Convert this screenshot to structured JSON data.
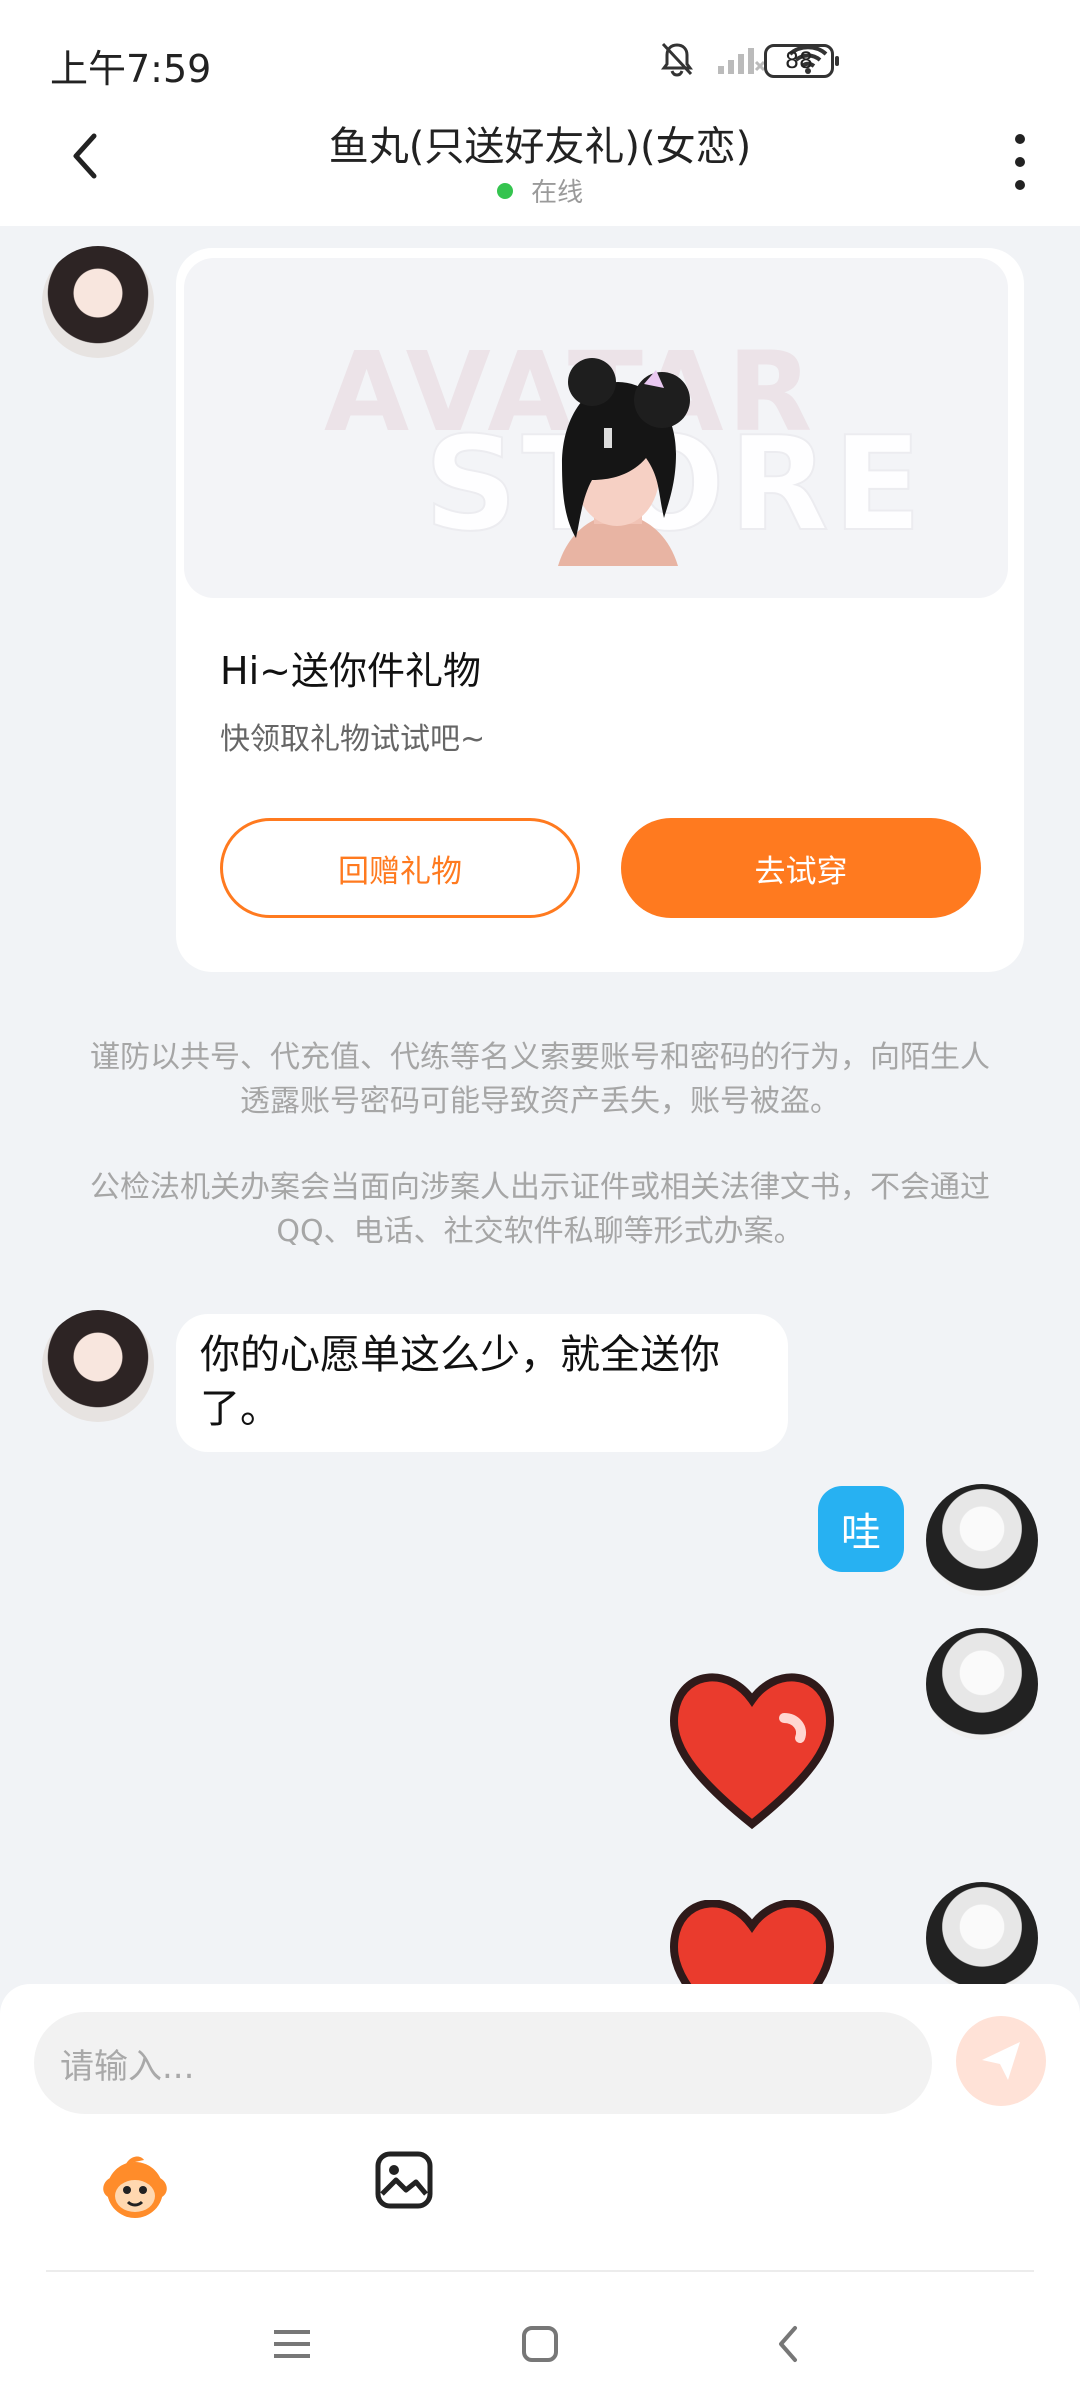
{
  "status_bar": {
    "time": "上午7:59",
    "battery": "88",
    "icons": [
      "mute-bell-icon",
      "signal-off-icon",
      "wifi-icon",
      "battery-icon"
    ]
  },
  "header": {
    "title": "鱼丸(只送好友礼)(女恋)",
    "status": "在线",
    "status_color": "#35c44f"
  },
  "gift_card": {
    "watermark_top": "AVATAR",
    "watermark_bottom": "STORE",
    "title": "Hi~送你件礼物",
    "subtitle": "快领取礼物试试吧~",
    "button_return": "回赠礼物",
    "button_try": "去试穿"
  },
  "notices": {
    "line1": "谨防以共号、代充值、代练等名义索要账号和密码的行为，向陌生人透露账号密码可能导致资产丢失，账号被盗。",
    "line2": "公检法机关办案会当面向涉案人出示证件或相关法律文书，不会通过QQ、电话、社交软件私聊等形式办案。"
  },
  "messages": {
    "left_text": "你的心愿单这么少，就全送你了。",
    "right_text": "哇"
  },
  "input": {
    "placeholder": "请输入..."
  },
  "colors": {
    "accent": "#ff7a1f",
    "bubble_blue": "#27b1f2",
    "background": "#f1f3f6"
  }
}
